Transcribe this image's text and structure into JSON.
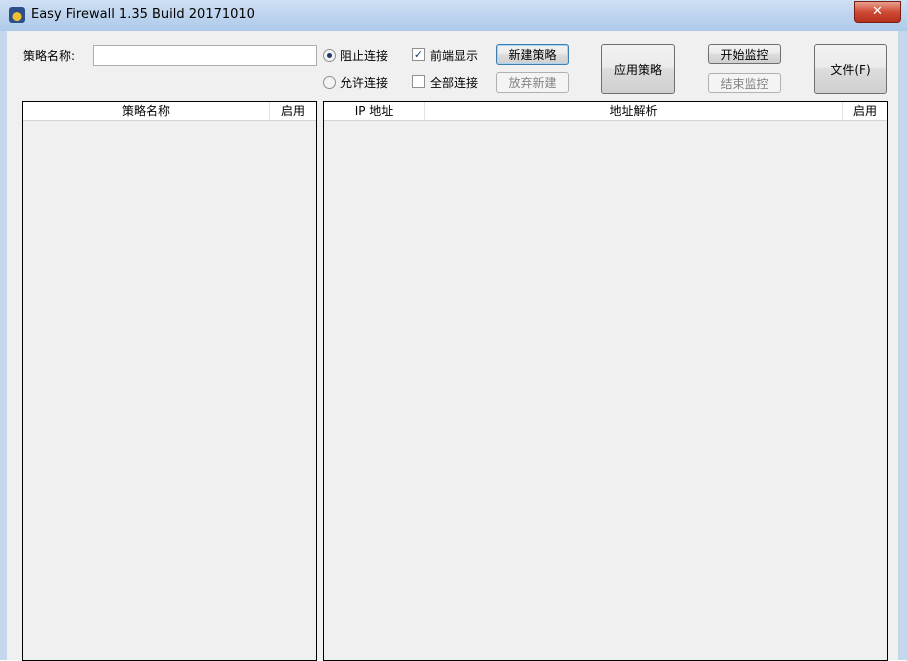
{
  "window": {
    "title": "Easy Firewall 1.35 Build 20171010",
    "close_symbol": "✕"
  },
  "form": {
    "name_label": "策略名称:",
    "name_value": "",
    "radio_block": {
      "label": "阻止连接",
      "checked": true
    },
    "radio_allow": {
      "label": "允许连接",
      "checked": false
    },
    "check_front": {
      "label": "前端显示",
      "checked": true,
      "mark": "✓"
    },
    "check_all": {
      "label": "全部连接",
      "checked": false,
      "mark": ""
    }
  },
  "buttons": {
    "new_policy": "新建策略",
    "discard_new": "放弃新建",
    "apply_policy": "应用策略",
    "start_monitor": "开始监控",
    "stop_monitor": "结束监控",
    "file": "文件(F)"
  },
  "policy_list": {
    "columns": [
      "策略名称",
      "启用"
    ],
    "rows": []
  },
  "address_list": {
    "columns": [
      "IP 地址",
      "地址解析",
      "启用"
    ],
    "rows": []
  },
  "icons": {
    "app": "firewall-shield-icon",
    "close": "close-icon"
  }
}
